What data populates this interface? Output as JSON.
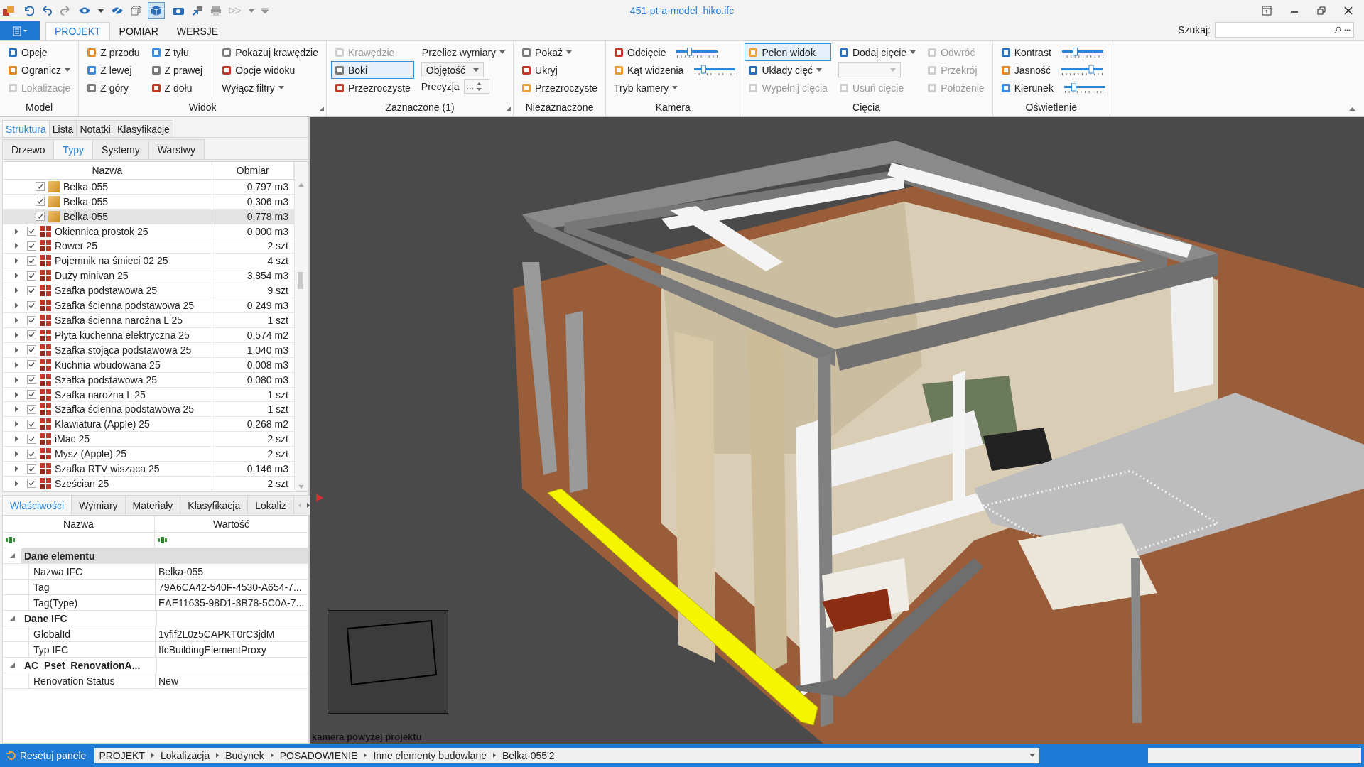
{
  "window": {
    "title": "451-pt-a-model_hiko.ifc"
  },
  "ribbon": {
    "tabs": [
      {
        "label": "PROJEKT",
        "selected": true
      },
      {
        "label": "POMIAR",
        "selected": false
      },
      {
        "label": "WERSJE",
        "selected": false
      }
    ],
    "search": {
      "label": "Szukaj:"
    },
    "groups": [
      {
        "title": "Model",
        "launcher": false,
        "columns": [
          [
            {
              "kind": "button",
              "label": "Opcje",
              "icon": true,
              "dropdown": false,
              "disabled": false
            },
            {
              "kind": "button",
              "label": "Ogranicz",
              "icon": true,
              "dropdown": true,
              "disabled": false
            },
            {
              "kind": "button",
              "label": "Lokalizacje",
              "icon": true,
              "dropdown": false,
              "disabled": true
            }
          ]
        ]
      },
      {
        "title": "Widok",
        "launcher": true,
        "columns": [
          [
            {
              "kind": "button",
              "label": "Z przodu",
              "icon": true,
              "dropdown": false,
              "disabled": false
            },
            {
              "kind": "button",
              "label": "Z lewej",
              "icon": true,
              "dropdown": false,
              "disabled": false
            },
            {
              "kind": "button",
              "label": "Z góry",
              "icon": true,
              "dropdown": false,
              "disabled": false
            }
          ],
          [
            {
              "kind": "button",
              "label": "Z tyłu",
              "icon": true,
              "dropdown": false,
              "disabled": false
            },
            {
              "kind": "button",
              "label": "Z prawej",
              "icon": true,
              "dropdown": false,
              "disabled": false
            },
            {
              "kind": "button",
              "label": "Z dołu",
              "icon": true,
              "dropdown": false,
              "disabled": false
            }
          ],
          [
            {
              "kind": "button",
              "label": "Pokazuj krawędzie",
              "icon": true,
              "dropdown": false,
              "disabled": false
            },
            {
              "kind": "button",
              "label": "Opcje widoku",
              "icon": true,
              "dropdown": false,
              "disabled": false
            },
            {
              "kind": "button",
              "label": "Wyłącz filtry",
              "icon": false,
              "dropdown": true,
              "disabled": false
            }
          ]
        ]
      },
      {
        "title": "Zaznaczone (1)",
        "launcher": true,
        "columns": [
          [
            {
              "kind": "toggle",
              "label": "Krawędzie",
              "selected": false,
              "disabled": true
            },
            {
              "kind": "toggle",
              "label": "Boki",
              "selected": true,
              "disabled": false
            },
            {
              "kind": "toggle",
              "label": "Przezroczyste",
              "selected": false,
              "disabled": false
            }
          ],
          [
            {
              "kind": "button",
              "label": "Przelicz wymiary",
              "icon": false,
              "dropdown": true,
              "disabled": false
            },
            {
              "kind": "combo",
              "value": "Objętość",
              "disabled": false
            },
            {
              "kind": "spinner",
              "label": "Precyzja",
              "value": "..."
            }
          ]
        ]
      },
      {
        "title": "Niezaznaczone",
        "launcher": false,
        "columns": [
          [
            {
              "kind": "button",
              "label": "Pokaż",
              "icon": true,
              "dropdown": true,
              "disabled": false
            },
            {
              "kind": "button",
              "label": "Ukryj",
              "icon": true,
              "dropdown": false,
              "disabled": false
            },
            {
              "kind": "button",
              "label": "Przezroczyste",
              "icon": true,
              "dropdown": false,
              "disabled": false
            }
          ]
        ]
      },
      {
        "title": "Kamera",
        "launcher": false,
        "columns": [
          [
            {
              "kind": "slider",
              "label": "Odcięcie",
              "level": 0.3
            },
            {
              "kind": "slider",
              "label": "Kąt widzenia",
              "level": 0.2
            },
            {
              "kind": "button",
              "label": "Tryb kamery",
              "icon": false,
              "dropdown": true,
              "disabled": false
            }
          ]
        ]
      },
      {
        "title": "Cięcia",
        "launcher": false,
        "columns": [
          [
            {
              "kind": "toggle",
              "label": "Pełen widok",
              "selected": true,
              "disabled": false
            },
            {
              "kind": "button",
              "label": "Układy cięć",
              "icon": true,
              "dropdown": true,
              "disabled": false
            },
            {
              "kind": "button",
              "label": "Wypełnij cięcia",
              "icon": true,
              "dropdown": false,
              "disabled": true
            }
          ],
          [
            {
              "kind": "button",
              "label": "Dodaj cięcie",
              "icon": true,
              "dropdown": true,
              "disabled": false
            },
            {
              "kind": "combo",
              "disabled": true
            },
            {
              "kind": "button",
              "label": "Usuń cięcie",
              "icon": true,
              "dropdown": false,
              "disabled": true
            }
          ],
          [
            {
              "kind": "button",
              "label": "Odwróć",
              "icon": true,
              "dropdown": false,
              "disabled": true
            },
            {
              "kind": "button",
              "label": "Przekrój",
              "icon": true,
              "dropdown": false,
              "disabled": true
            },
            {
              "kind": "button",
              "label": "Położenie",
              "icon": true,
              "dropdown": false,
              "disabled": true
            }
          ]
        ]
      },
      {
        "title": "Oświetlenie",
        "launcher": false,
        "columns": [
          [
            {
              "kind": "slider",
              "label": "Kontrast",
              "level": 0.3
            },
            {
              "kind": "slider",
              "label": "Jasność",
              "level": 0.75
            },
            {
              "kind": "slider",
              "label": "Kierunek",
              "level": 0.2
            }
          ]
        ]
      }
    ]
  },
  "structure_panel": {
    "tabs": [
      {
        "label": "Struktura",
        "selected": true
      },
      {
        "label": "Lista",
        "selected": false
      },
      {
        "label": "Notatki",
        "selected": false
      },
      {
        "label": "Klasyfikacje",
        "selected": false
      }
    ],
    "subtabs": [
      {
        "label": "Drzewo",
        "selected": false
      },
      {
        "label": "Typy",
        "selected": true
      },
      {
        "label": "Systemy",
        "selected": false
      },
      {
        "label": "Warstwy",
        "selected": false
      }
    ],
    "columns": [
      "Nazwa",
      "Obmiar"
    ],
    "rows": [
      {
        "kind": "element",
        "name": "Belka-055",
        "value": "0,797 m3",
        "checked": true,
        "selected": false
      },
      {
        "kind": "element",
        "name": "Belka-055",
        "value": "0,306 m3",
        "checked": true,
        "selected": false
      },
      {
        "kind": "element",
        "name": "Belka-055",
        "value": "0,778 m3",
        "checked": true,
        "selected": true
      },
      {
        "kind": "type",
        "name": "Okiennica prostok 25",
        "value": "0,000 m3",
        "checked": true,
        "selected": false
      },
      {
        "kind": "type",
        "name": "Rower 25",
        "value": "2 szt",
        "checked": true,
        "selected": false
      },
      {
        "kind": "type",
        "name": "Pojemnik na śmieci 02 25",
        "value": "4 szt",
        "checked": true,
        "selected": false
      },
      {
        "kind": "type",
        "name": "Duży minivan 25",
        "value": "3,854 m3",
        "checked": true,
        "selected": false
      },
      {
        "kind": "type",
        "name": "Szafka podstawowa 25",
        "value": "9 szt",
        "checked": true,
        "selected": false
      },
      {
        "kind": "type",
        "name": "Szafka ścienna podstawowa 25",
        "value": "0,249 m3",
        "checked": true,
        "selected": false
      },
      {
        "kind": "type",
        "name": "Szafka ścienna narożna L 25",
        "value": "1 szt",
        "checked": true,
        "selected": false
      },
      {
        "kind": "type",
        "name": "Płyta kuchenna elektryczna 25",
        "value": "0,574 m2",
        "checked": true,
        "selected": false
      },
      {
        "kind": "type",
        "name": "Szafka stojąca podstawowa 25",
        "value": "1,040 m3",
        "checked": true,
        "selected": false
      },
      {
        "kind": "type",
        "name": "Kuchnia wbudowana 25",
        "value": "0,008 m3",
        "checked": true,
        "selected": false
      },
      {
        "kind": "type",
        "name": "Szafka podstawowa 25",
        "value": "0,080 m3",
        "checked": true,
        "selected": false
      },
      {
        "kind": "type",
        "name": "Szafka narożna L 25",
        "value": "1 szt",
        "checked": true,
        "selected": false
      },
      {
        "kind": "type",
        "name": "Szafka ścienna podstawowa 25",
        "value": "1 szt",
        "checked": true,
        "selected": false
      },
      {
        "kind": "type",
        "name": "Klawiatura (Apple) 25",
        "value": "0,268 m2",
        "checked": true,
        "selected": false
      },
      {
        "kind": "type",
        "name": "iMac 25",
        "value": "2 szt",
        "checked": true,
        "selected": false
      },
      {
        "kind": "type",
        "name": "Mysz (Apple) 25",
        "value": "2 szt",
        "checked": true,
        "selected": false
      },
      {
        "kind": "type",
        "name": "Szafka RTV wisząca 25",
        "value": "0,146 m3",
        "checked": true,
        "selected": false
      },
      {
        "kind": "type",
        "name": "Sześcian 25",
        "value": "2 szt",
        "checked": true,
        "selected": false
      }
    ]
  },
  "properties_panel": {
    "tabs": [
      {
        "label": "Właściwości",
        "selected": true
      },
      {
        "label": "Wymiary",
        "selected": false
      },
      {
        "label": "Materiały",
        "selected": false
      },
      {
        "label": "Klasyfikacja",
        "selected": false
      },
      {
        "label": "Lokaliz",
        "selected": false
      }
    ],
    "columns": [
      "Nazwa",
      "Wartość"
    ],
    "groups": [
      {
        "title": "Dane elementu",
        "expanded": true,
        "selected": true,
        "rows": [
          {
            "name": "Nazwa IFC",
            "value": "Belka-055"
          },
          {
            "name": "Tag",
            "value": "79A6CA42-540F-4530-A654-7..."
          },
          {
            "name": "Tag(Type)",
            "value": "EAE11635-98D1-3B78-5C0A-7..."
          }
        ]
      },
      {
        "title": "Dane IFC",
        "expanded": true,
        "selected": false,
        "rows": [
          {
            "name": "GlobalId",
            "value": "1vfif2L0z5CAPKT0rC3jdM"
          },
          {
            "name": "Typ IFC",
            "value": "IfcBuildingElementProxy"
          }
        ]
      },
      {
        "title": "AC_Pset_RenovationA...",
        "expanded": true,
        "selected": false,
        "rows": [
          {
            "name": "Renovation Status",
            "value": "New"
          }
        ]
      }
    ]
  },
  "viewport": {
    "camera_label": "kamera powyżej projektu"
  },
  "status_bar": {
    "reset_button": "Resetuj panele",
    "breadcrumb": [
      "PROJEKT",
      "Lokalizacja",
      "Budynek",
      "POSADOWIENIE",
      "Inne elementy budowlane",
      "Belka-055'2"
    ]
  }
}
